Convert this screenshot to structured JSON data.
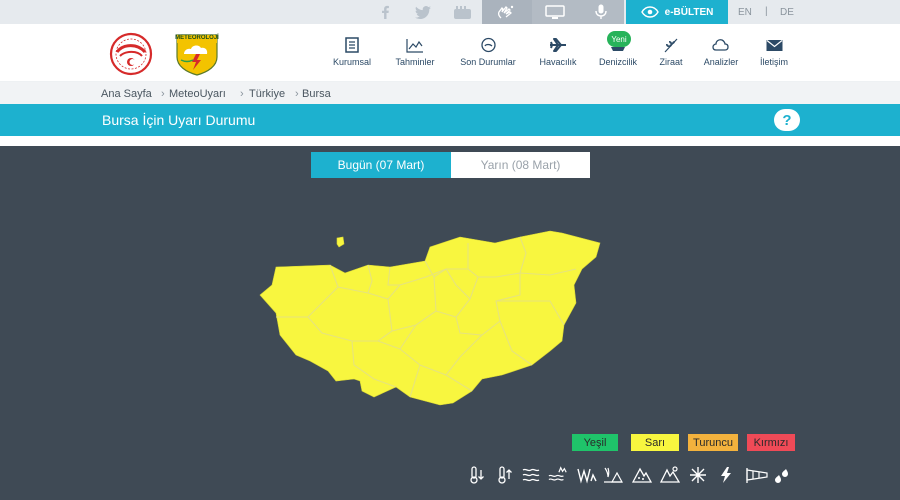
{
  "header": {
    "nav": [
      {
        "label": "Kurumsal"
      },
      {
        "label": "Tahminler"
      },
      {
        "label": "Son Durumlar"
      },
      {
        "label": "Havacılık"
      },
      {
        "label": "Denizcilik",
        "badge": "Yeni"
      },
      {
        "label": "Ziraat"
      },
      {
        "label": "Analizler"
      },
      {
        "label": "İletişim"
      }
    ],
    "logo2_text": "METEOROLOJİ"
  },
  "topbar": {
    "bulten_label": "e-BÜLTEN",
    "lang_en": "EN",
    "lang_sep": "|",
    "lang_de": "DE"
  },
  "breadcrumb": {
    "items": [
      "Ana Sayfa",
      "MeteoUyarı",
      "Türkiye",
      "Bursa"
    ],
    "separator": "›"
  },
  "page": {
    "title": "Bursa İçin Uyarı Durumu",
    "help_label": "?"
  },
  "tabs": [
    {
      "label": "Bugün (07 Mart)",
      "active": true
    },
    {
      "label": "Yarın (08 Mart)",
      "active": false
    }
  ],
  "map": {
    "region": "Bursa",
    "level_color": "#f8f63f"
  },
  "legend": [
    {
      "label": "Yeşil",
      "color": "#1fc46a"
    },
    {
      "label": "Sarı",
      "color": "#f8f63f"
    },
    {
      "label": "Turuncu",
      "color": "#f3b23d"
    },
    {
      "label": "Kırmızı",
      "color": "#ef4a57"
    }
  ],
  "colors": {
    "accent": "#1db1cf",
    "map_background": "#3f4a55",
    "topbar": "#e6eaee",
    "nav_text": "#2c4a66"
  },
  "hazard_icons": [
    "low-temperature-icon",
    "high-temperature-icon",
    "wind-icon",
    "storm-icon",
    "fog-icon",
    "avalanche-icon",
    "icing-icon",
    "snow-icon",
    "thunderstorm-icon",
    "windsock-icon",
    "rain-icon"
  ]
}
